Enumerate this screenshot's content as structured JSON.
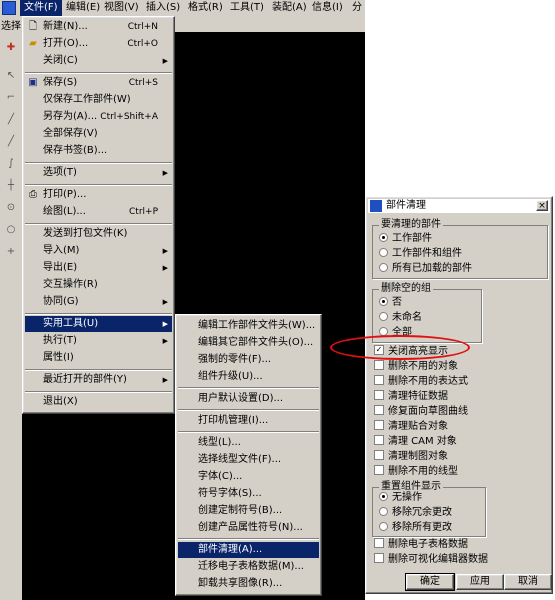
{
  "menubar": {
    "items": [
      "文件(F)",
      "编辑(E)",
      "视图(V)",
      "插入(S)",
      "格式(R)",
      "工具(T)",
      "装配(A)",
      "信息(I)",
      "分"
    ]
  },
  "leftstrip": {
    "select_label": "选择"
  },
  "file_menu": {
    "items": [
      {
        "label": "新建(N)...",
        "shortcut": "Ctrl+N"
      },
      {
        "label": "打开(O)...",
        "shortcut": "Ctrl+O"
      },
      {
        "label": "关闭(C)"
      },
      {
        "label": "保存(S)",
        "shortcut": "Ctrl+S"
      },
      {
        "label": "仅保存工作部件(W)"
      },
      {
        "label": "另存为(A)...",
        "shortcut": "Ctrl+Shift+A"
      },
      {
        "label": "全部保存(V)"
      },
      {
        "label": "保存书签(B)..."
      },
      {
        "label": "选项(T)"
      },
      {
        "label": "打印(P)..."
      },
      {
        "label": "绘图(L)...",
        "shortcut": "Ctrl+P"
      },
      {
        "label": "发送到打包文件(K)"
      },
      {
        "label": "导入(M)"
      },
      {
        "label": "导出(E)"
      },
      {
        "label": "交互操作(R)"
      },
      {
        "label": "协同(G)"
      },
      {
        "label": "实用工具(U)"
      },
      {
        "label": "执行(T)"
      },
      {
        "label": "属性(I)"
      },
      {
        "label": "最近打开的部件(Y)"
      },
      {
        "label": "退出(X)"
      }
    ]
  },
  "utility_submenu": {
    "items": [
      "编辑工作部件文件头(W)...",
      "编辑其它部件文件头(O)...",
      "强制的零件(F)...",
      "组件升级(U)...",
      "用户默认设置(D)...",
      "打印机管理(I)...",
      "线型(L)...",
      "选择线型文件(F)...",
      "字体(C)...",
      "符号字体(S)...",
      "创建定制符号(B)...",
      "创建产品属性符号(N)...",
      "部件清理(A)...",
      "迁移电子表格数据(M)...",
      "卸载共享图像(R)..."
    ]
  },
  "dialog": {
    "title": "部件清理",
    "close": "×",
    "group_parts": {
      "title": "要清理的部件",
      "options": [
        "工作部件",
        "工作部件和组件",
        "所有已加载的部件"
      ],
      "selected": 0
    },
    "group_empty": {
      "title": "删除空的组",
      "options": [
        "否",
        "未命名",
        "全部"
      ],
      "selected": 0
    },
    "checks": [
      {
        "label": "关闭高亮显示",
        "checked": true
      },
      {
        "label": "删除不用的对象",
        "checked": false
      },
      {
        "label": "删除不用的表达式",
        "checked": false
      },
      {
        "label": "清理特征数据",
        "checked": false
      },
      {
        "label": "修复面向草图曲线",
        "checked": false
      },
      {
        "label": "清理贴合对象",
        "checked": false
      },
      {
        "label": "清理 CAM 对象",
        "checked": false
      },
      {
        "label": "清理制图对象",
        "checked": false
      },
      {
        "label": "删除不用的线型",
        "checked": false
      }
    ],
    "group_reset": {
      "title": "重置组件显示",
      "options": [
        "无操作",
        "移除冗余更改",
        "移除所有更改"
      ],
      "selected": 0
    },
    "checks2": [
      {
        "label": "删除电子表格数据",
        "checked": false
      },
      {
        "label": "删除可视化编辑器数据",
        "checked": false
      }
    ],
    "buttons": {
      "ok": "确定",
      "apply": "应用",
      "cancel": "取消"
    }
  },
  "colors": {
    "menu_bg": "#d4d0c8",
    "highlight": "#0a246a",
    "canvas": "#000000",
    "annotation": "#e01010"
  }
}
